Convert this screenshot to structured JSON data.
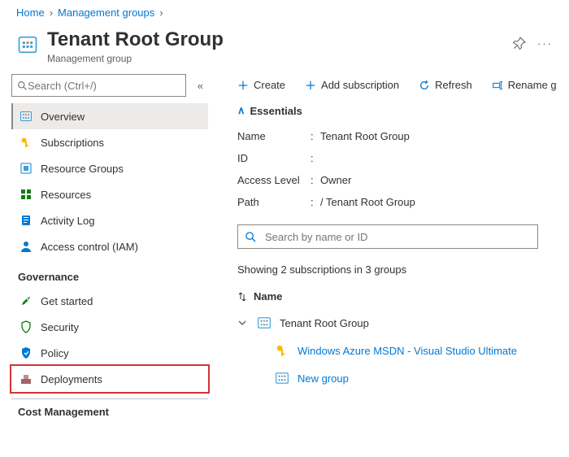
{
  "breadcrumb": {
    "home": "Home",
    "mg": "Management groups"
  },
  "header": {
    "title": "Tenant Root Group",
    "sub": "Management group"
  },
  "sidebar": {
    "search_placeholder": "Search (Ctrl+/)",
    "items": {
      "overview": "Overview",
      "subscriptions": "Subscriptions",
      "resource_groups": "Resource Groups",
      "resources": "Resources",
      "activity": "Activity Log",
      "access": "Access control (IAM)"
    },
    "gov_header": "Governance",
    "gov": {
      "get_started": "Get started",
      "security": "Security",
      "policy": "Policy",
      "deployments": "Deployments"
    },
    "cost_header": "Cost Management"
  },
  "toolbar": {
    "create": "Create",
    "add_sub": "Add subscription",
    "refresh": "Refresh",
    "rename": "Rename g"
  },
  "essentials": {
    "header": "Essentials",
    "rows": {
      "name_lbl": "Name",
      "name_val": "Tenant Root Group",
      "id_lbl": "ID",
      "id_val": "",
      "access_lbl": "Access Level",
      "access_val": "Owner",
      "path_lbl": "Path",
      "path_val": "/ Tenant Root Group"
    }
  },
  "filter": {
    "placeholder": "Search by name or ID"
  },
  "summary": "Showing 2 subscriptions in 3 groups",
  "tree": {
    "col_name": "Name",
    "root": "Tenant Root Group",
    "sub1": "Windows Azure MSDN - Visual Studio Ultimate",
    "group1": "New group"
  }
}
